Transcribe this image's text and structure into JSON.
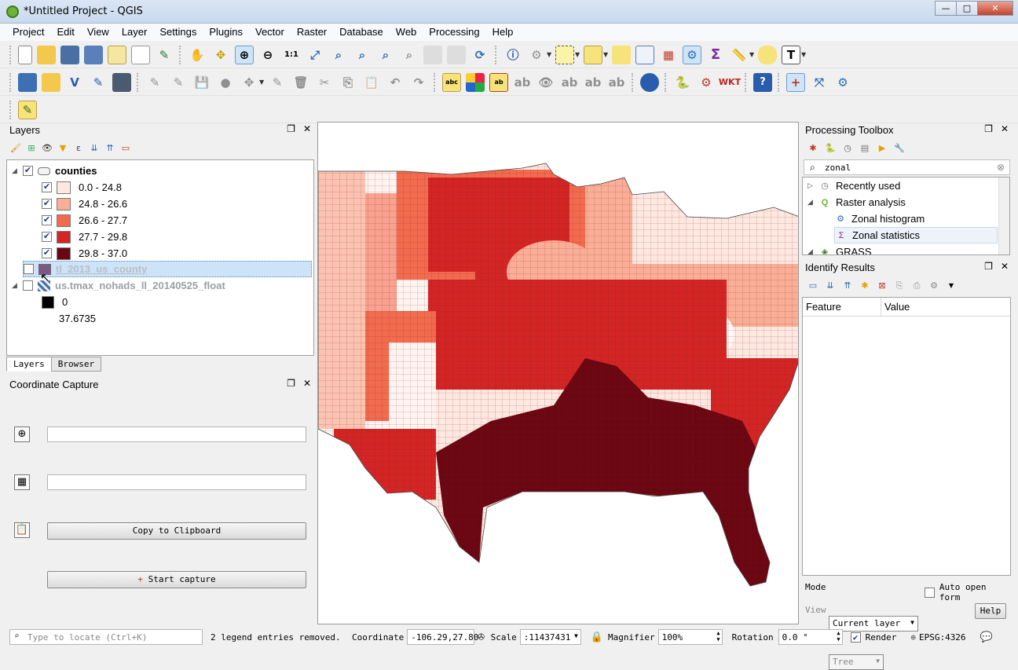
{
  "window": {
    "title": "*Untitled Project - QGIS",
    "buttons": {
      "minimize": "—",
      "maximize": "□",
      "close": "✕"
    }
  },
  "menubar": [
    "Project",
    "Edit",
    "View",
    "Layer",
    "Settings",
    "Plugins",
    "Vector",
    "Raster",
    "Database",
    "Web",
    "Processing",
    "Help"
  ],
  "layers_panel": {
    "title": "Layers",
    "tree": {
      "counties": {
        "name": "counties",
        "classes": [
          {
            "label": "0.0 - 24.8",
            "color": "#fee8e0"
          },
          {
            "label": "24.8 - 26.6",
            "color": "#fbae96"
          },
          {
            "label": "26.6 - 27.7",
            "color": "#f36b4f"
          },
          {
            "label": "27.7 - 29.8",
            "color": "#d42525"
          },
          {
            "label": "29.8 - 37.0",
            "color": "#6b0712"
          }
        ]
      },
      "county_layer": {
        "name": "tl_2013_us_county",
        "color": "#7b5a80"
      },
      "raster_layer": {
        "name": "us.tmax_nohads_ll_20140525_float",
        "min": "0",
        "max": "37.6735"
      }
    },
    "tabs": [
      "Layers",
      "Browser"
    ]
  },
  "coord_panel": {
    "title": "Coordinate Capture",
    "copy_button": "Copy to Clipboard",
    "start_button": "Start capture"
  },
  "toolbox_panel": {
    "title": "Processing Toolbox",
    "search_value": "zonal",
    "items": [
      "Recently used",
      "Raster analysis",
      "Zonal histogram",
      "Zonal statistics",
      "GRASS"
    ]
  },
  "identify_panel": {
    "title": "Identify Results",
    "columns": [
      "Feature",
      "Value"
    ],
    "mode_label": "Mode",
    "mode_value": "Current layer",
    "auto_open_label": "Auto open form",
    "view_label": "View",
    "view_value": "Tree",
    "help_button": "Help"
  },
  "statusbar": {
    "locate_placeholder": "Type to locate (Ctrl+K)",
    "message": "2 legend entries removed.",
    "coordinate_label": "Coordinate",
    "coordinate_value": "-106.29,27.80",
    "scale_label": "Scale",
    "scale_value": ":11437431",
    "magnifier_label": "Magnifier",
    "magnifier_value": "100%",
    "rotation_label": "Rotation",
    "rotation_value": "0.0 °",
    "render_label": "Render",
    "crs": "EPSG:4326"
  },
  "colors": {
    "class_1": "#fee8e0",
    "class_2": "#fbae96",
    "class_3": "#f36b4f",
    "class_4": "#d42525",
    "class_5": "#6b0712",
    "selection": "#cde3f7"
  }
}
